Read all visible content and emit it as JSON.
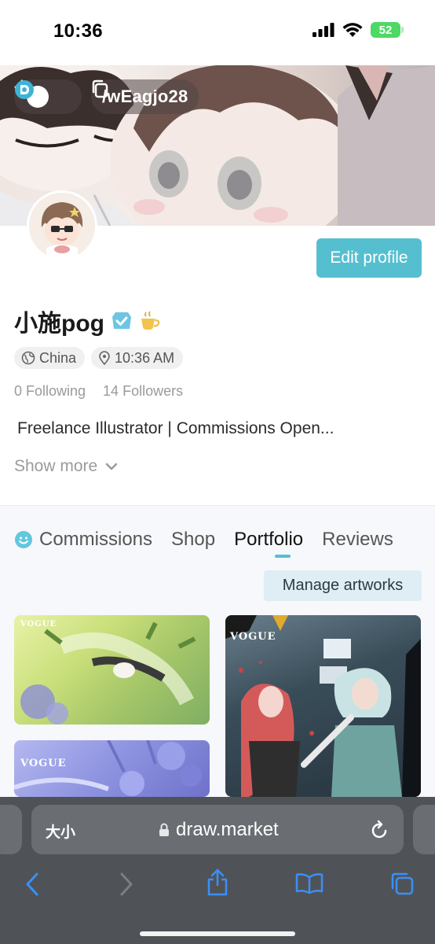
{
  "status_bar": {
    "time": "10:36",
    "battery": "52"
  },
  "header": {
    "handle": "/wEagjo28"
  },
  "profile": {
    "name": "小施pog",
    "location": "China",
    "local_time": "10:36 AM",
    "following": "0 Following",
    "followers": "14 Followers",
    "bio": "Freelance Illustrator | Commissions Open...",
    "show_more": "Show more",
    "edit_profile": "Edit profile"
  },
  "tabs": [
    {
      "label": "Commissions"
    },
    {
      "label": "Shop"
    },
    {
      "label": "Portfolio",
      "active": true
    },
    {
      "label": "Reviews"
    }
  ],
  "portfolio": {
    "manage_label": "Manage artworks",
    "artworks": [
      {
        "caption": "VOGUE"
      },
      {
        "caption": "VOGUE"
      },
      {
        "caption": "VOGUE"
      }
    ]
  },
  "browser": {
    "text_size_label": "大小",
    "url": "draw.market"
  },
  "colors": {
    "accent": "#55bfd0",
    "battery": "#4cd964"
  }
}
